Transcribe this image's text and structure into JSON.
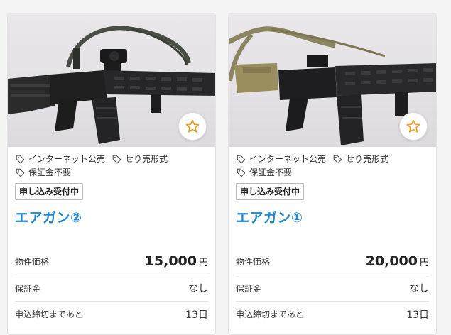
{
  "listings": [
    {
      "tags": [
        "インターネット公売",
        "せり売形式",
        "保証金不要"
      ],
      "status_badge": "申し込み受付中",
      "title": "エアガン②",
      "price_label": "物件価格",
      "price_value": "15,000",
      "price_unit": "円",
      "deposit_label": "保証金",
      "deposit_value": "なし",
      "deadline_label": "申込締切まであと",
      "deadline_value": "13日",
      "icons": {
        "tag": "tag-icon",
        "favorite": "star-icon"
      }
    },
    {
      "tags": [
        "インターネット公売",
        "せり売形式",
        "保証金不要"
      ],
      "status_badge": "申し込み受付中",
      "title": "エアガン①",
      "price_label": "物件価格",
      "price_value": "20,000",
      "price_unit": "円",
      "deposit_label": "保証金",
      "deposit_value": "なし",
      "deadline_label": "申込締切まであと",
      "deadline_value": "13日",
      "icons": {
        "tag": "tag-icon",
        "favorite": "star-icon"
      }
    }
  ],
  "colors": {
    "title_link": "#1e88d7",
    "star": "#f0a020",
    "card_border": "#e3e3e3",
    "page_background": "#f3f3f3"
  }
}
